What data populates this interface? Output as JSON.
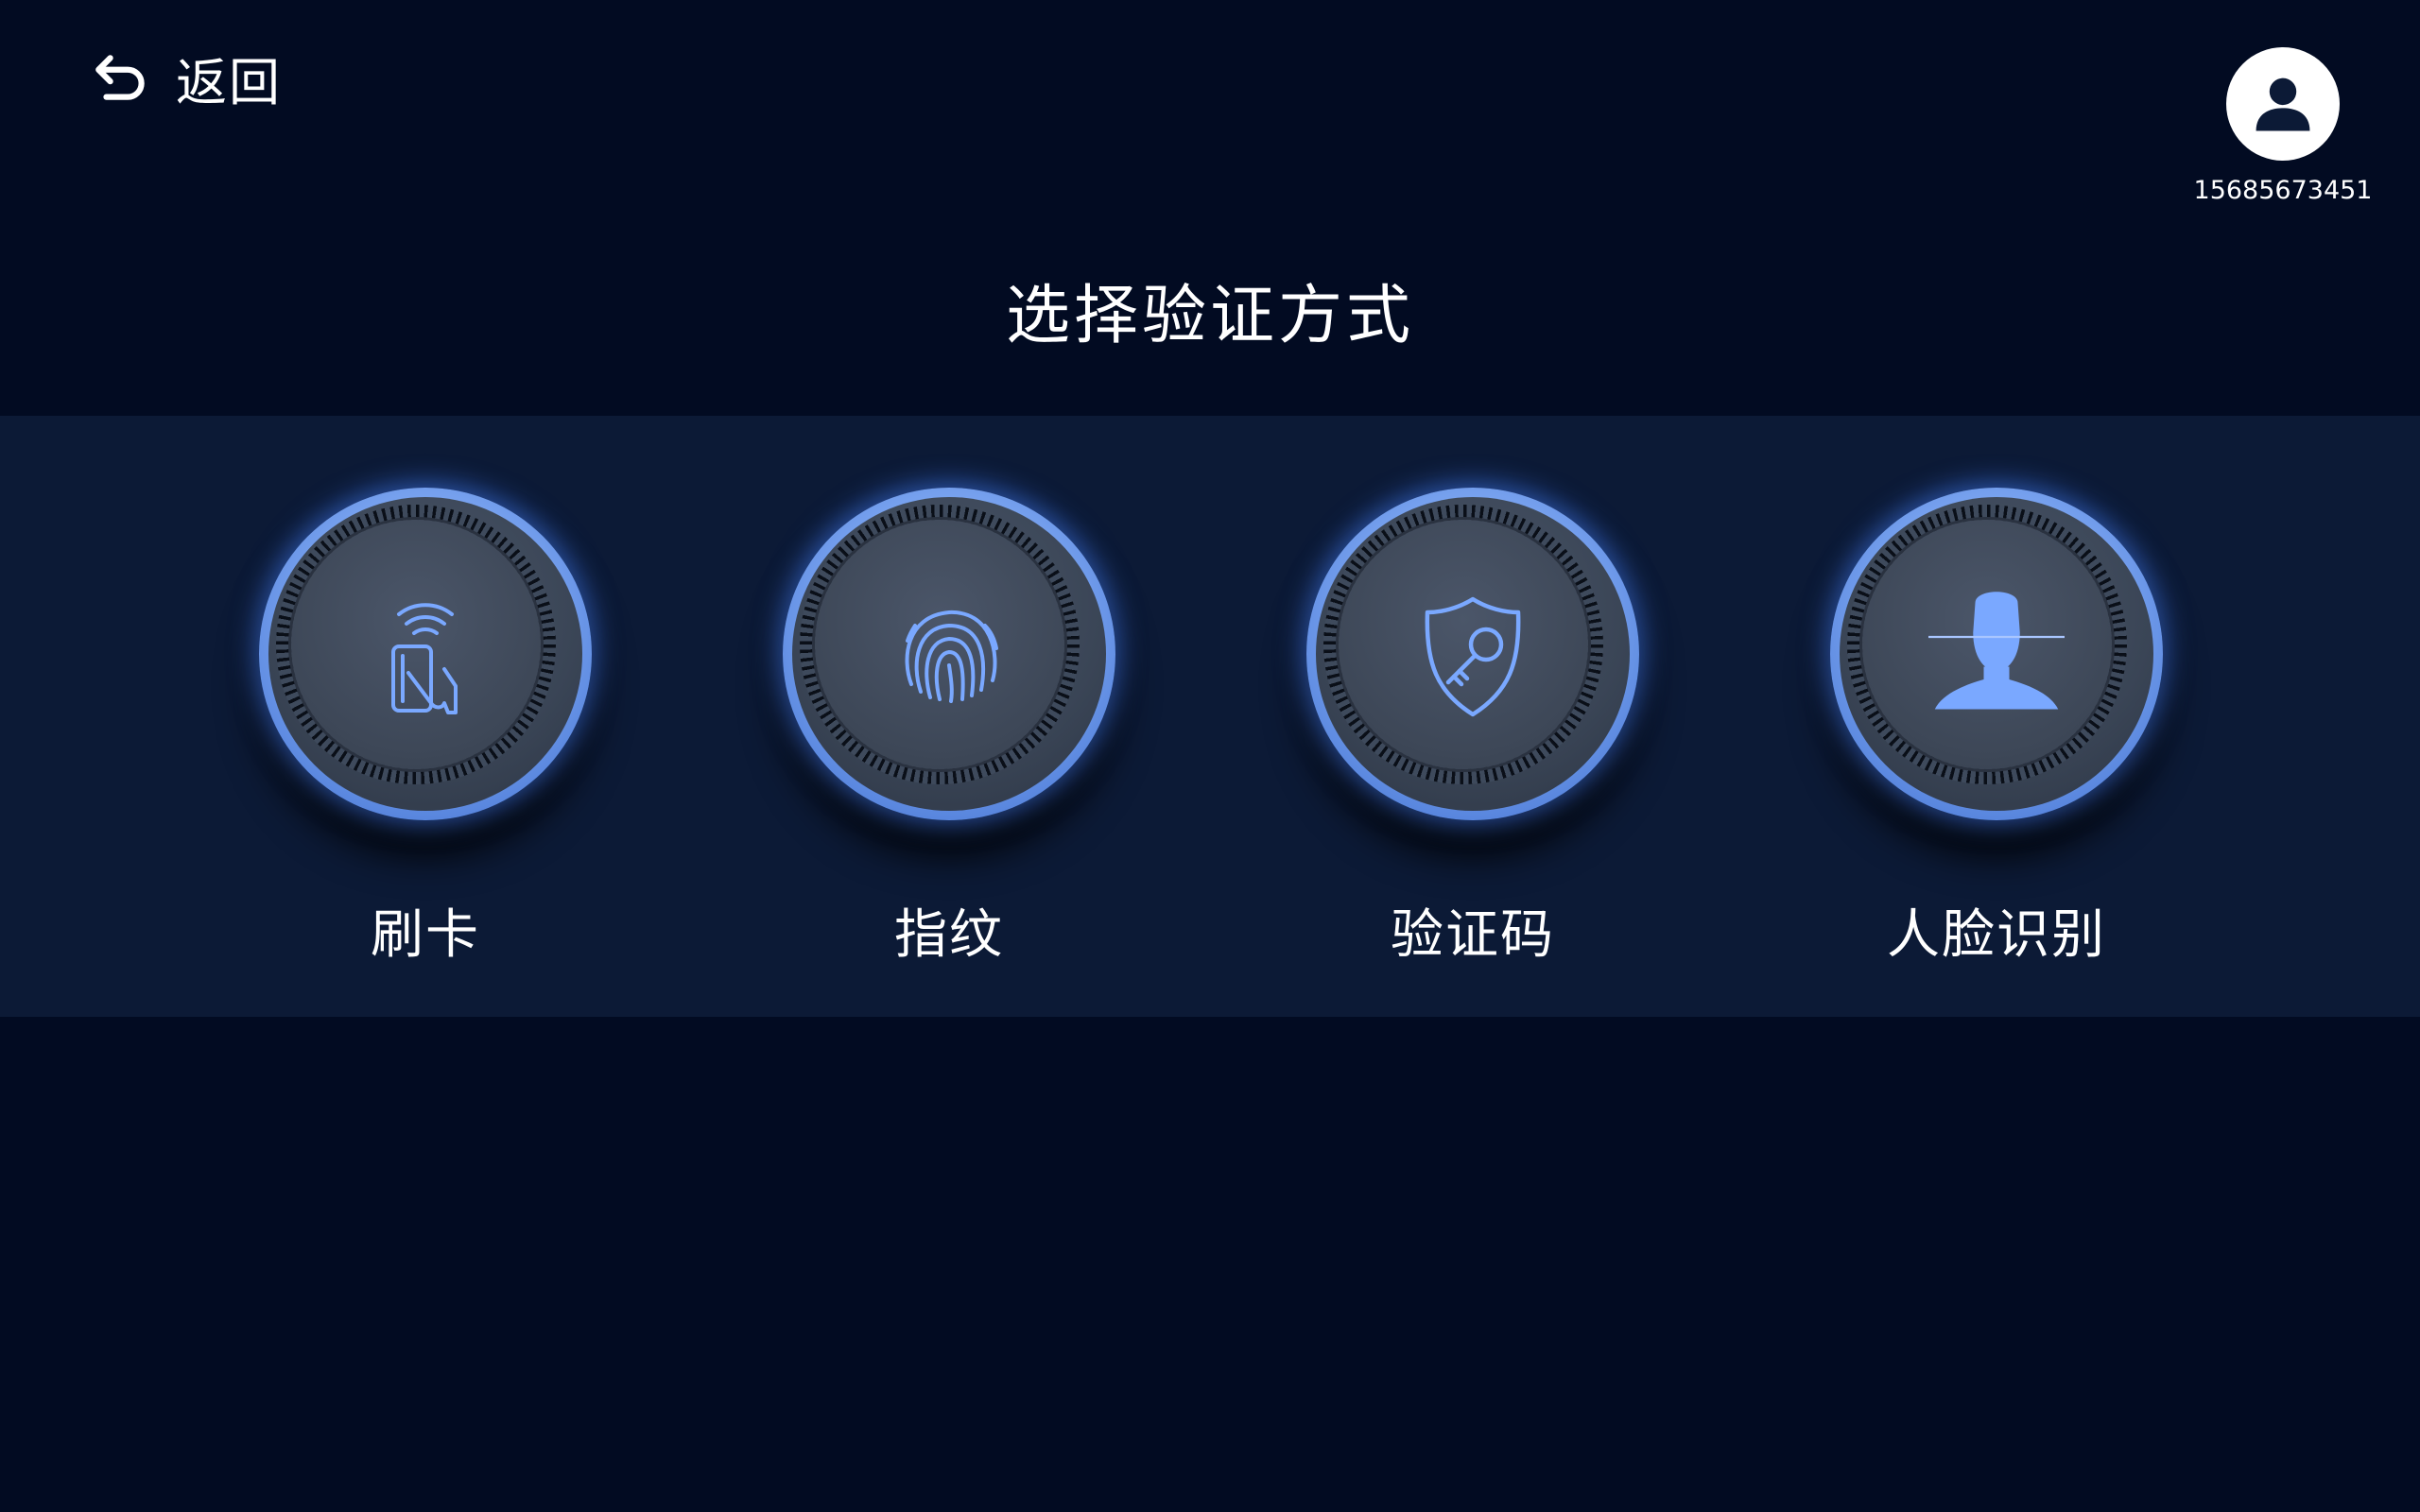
{
  "header": {
    "back_label": "返回",
    "back_icon": "undo-arrow-icon",
    "avatar_icon": "user-icon",
    "phone": "15685673451"
  },
  "title": "选择验证方式",
  "options": [
    {
      "label": "刷卡",
      "icon": "card-swipe-icon"
    },
    {
      "label": "指纹",
      "icon": "fingerprint-icon"
    },
    {
      "label": "验证码",
      "icon": "shield-key-icon"
    },
    {
      "label": "人脸识别",
      "icon": "face-scan-icon"
    }
  ],
  "colors": {
    "background": "#020b22",
    "band": "#0c1a36",
    "accent": "#7aa8ff",
    "text": "#ffffff"
  }
}
